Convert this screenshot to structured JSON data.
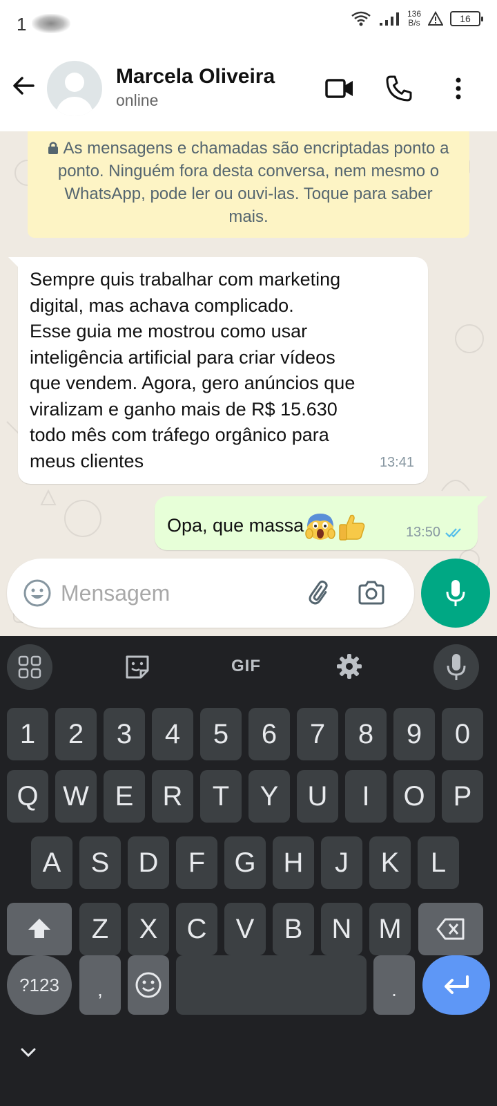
{
  "status_bar": {
    "time": "1",
    "net_speed_value": "136",
    "net_speed_unit": "B/s",
    "battery": "16"
  },
  "header": {
    "contact_name": "Marcela Oliveira",
    "contact_status": "online",
    "icons": [
      "back-arrow-icon",
      "avatar",
      "video-call-icon",
      "voice-call-icon",
      "more-vert-icon"
    ]
  },
  "chat": {
    "encryption_notice": "As mensagens e chamadas são encriptadas ponto a ponto. Ninguém fora desta conversa, nem mesmo o WhatsApp, pode ler ou ouvi-las. Toque para saber mais.",
    "messages": [
      {
        "direction": "incoming",
        "text": "Sempre quis trabalhar com marketing\ndigital, mas achava complicado.\nEsse guia me mostrou como usar\ninteligência artificial para criar vídeos\nque vendem. Agora, gero anúncios que\nviralizam e ganho mais de R$ 15.630\ntodo mês com tráfego orgânico para\nmeus clientes",
        "time": "13:41"
      },
      {
        "direction": "outgoing",
        "text": "Opa, que massa",
        "emojis": [
          "face-screaming-in-fear",
          "thumbs-up"
        ],
        "time": "13:50",
        "status": "read"
      }
    ]
  },
  "composer": {
    "placeholder": "Mensagem"
  },
  "keyboard": {
    "toolbar_gif": "GIF",
    "row_numbers": [
      "1",
      "2",
      "3",
      "4",
      "5",
      "6",
      "7",
      "8",
      "9",
      "0"
    ],
    "row_1": [
      "Q",
      "W",
      "E",
      "R",
      "T",
      "Y",
      "U",
      "I",
      "O",
      "P"
    ],
    "row_2": [
      "A",
      "S",
      "D",
      "F",
      "G",
      "H",
      "J",
      "K",
      "L"
    ],
    "row_3": [
      "Z",
      "X",
      "C",
      "V",
      "B",
      "N",
      "M"
    ],
    "symbols_key": "?123",
    "comma_key": ",",
    "period_key": "."
  },
  "colors": {
    "accent": "#00a884",
    "outgoing_bubble": "#e7ffd8",
    "encryption_banner": "#fdf4c5",
    "keyboard_bg": "#202124",
    "enter_key": "#5e97f6"
  }
}
